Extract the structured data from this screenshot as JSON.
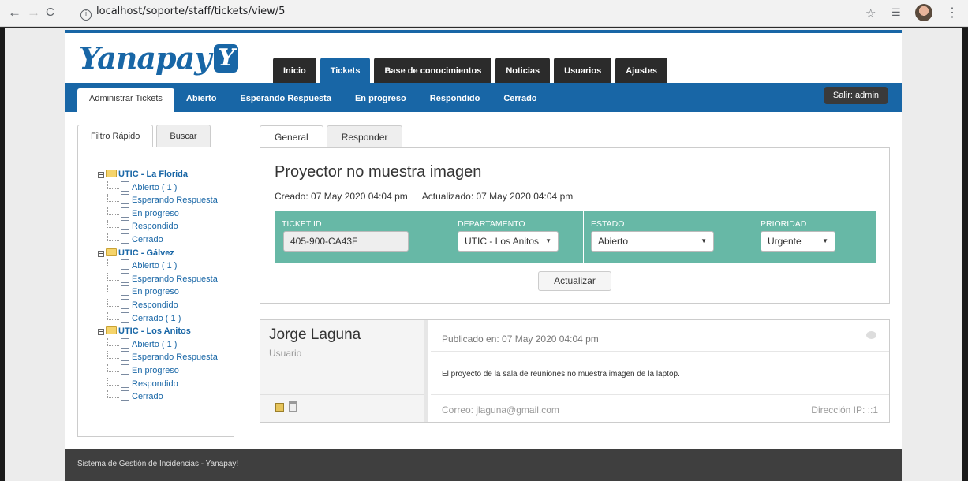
{
  "browser": {
    "url": "localhost/soporte/staff/tickets/view/5",
    "back": "←",
    "forward": "→",
    "reload": "C",
    "info": "i",
    "star": "☆",
    "ext": "☰",
    "menu": "⋮"
  },
  "logo": {
    "text": "Yanapay",
    "mark": "Y"
  },
  "main_nav": {
    "tabs": [
      "Inicio",
      "Tickets",
      "Base de conocimientos",
      "Noticias",
      "Usuarios",
      "Ajustes"
    ],
    "active": "Tickets"
  },
  "sub_nav": {
    "items": [
      "Administrar Tickets",
      "Abierto",
      "Esperando Respuesta",
      "En progreso",
      "Respondido",
      "Cerrado"
    ],
    "active": "Administrar Tickets",
    "logout": "Salir: admin"
  },
  "left": {
    "tabs": [
      "Filtro Rápido",
      "Buscar"
    ],
    "tree": [
      {
        "group": "UTIC - La Florida",
        "items": [
          "Abierto ( 1 )",
          "Esperando Respuesta",
          "En progreso",
          "Respondido",
          "Cerrado"
        ]
      },
      {
        "group": "UTIC - Gálvez",
        "items": [
          "Abierto ( 1 )",
          "Esperando Respuesta",
          "En progreso",
          "Respondido",
          "Cerrado ( 1 )"
        ]
      },
      {
        "group": "UTIC - Los Anitos",
        "items": [
          "Abierto ( 1 )",
          "Esperando Respuesta",
          "En progreso",
          "Respondido",
          "Cerrado"
        ]
      }
    ]
  },
  "ticket": {
    "tabs": [
      "General",
      "Responder"
    ],
    "title": "Proyector no muestra imagen",
    "created": "Creado: 07 May 2020 04:04 pm",
    "updated": "Actualizado: 07 May 2020 04:04 pm",
    "labels": {
      "id": "TICKET ID",
      "dept": "DEPARTAMENTO",
      "status": "ESTADO",
      "priority": "PRIORIDAD"
    },
    "values": {
      "id": "405-900-CA43F",
      "dept": "UTIC - Los Anitos",
      "status": "Abierto",
      "priority": "Urgente"
    },
    "update_button": "Actualizar"
  },
  "message": {
    "author": "Jorge Laguna",
    "role": "Usuario",
    "published": "Publicado en: 07 May 2020 04:04 pm",
    "body": "El proyecto de la sala de reuniones no muestra imagen de la laptop.",
    "email": "Correo: jlaguna@gmail.com",
    "ip": "Dirección IP: ::1"
  },
  "footer": {
    "text": "Sistema de Gestión de Incidencias - Yanapay!"
  }
}
